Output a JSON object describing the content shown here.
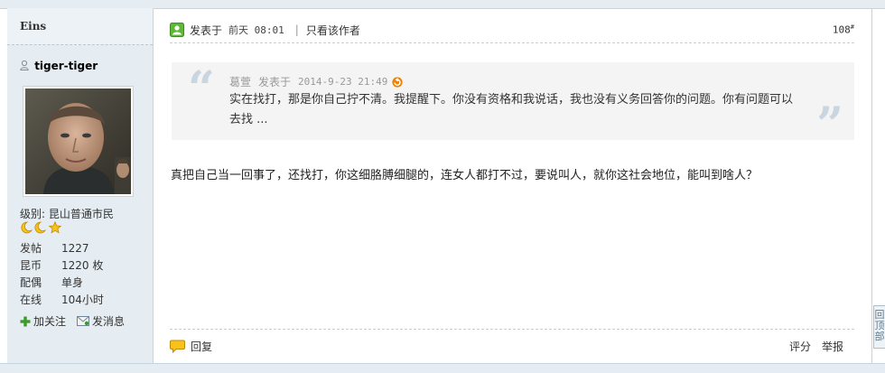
{
  "colors": {
    "sidebar_bg": "#e5edf2",
    "border": "#c2d5e3",
    "quote_bg": "#f4f4f4",
    "accent_orange": "#f08000"
  },
  "author": {
    "name_bar": "Eins",
    "username": "tiger-tiger",
    "level": "级别: 昆山普通市民",
    "stars": [
      "moon-icon",
      "moon-icon",
      "star-icon"
    ],
    "stats": [
      {
        "key": "发帖",
        "value": "1227"
      },
      {
        "key": "昆币",
        "value": "1220 枚"
      },
      {
        "key": "配偶",
        "value": "单身"
      },
      {
        "key": "在线",
        "value": "104小时"
      }
    ],
    "follow_label": "加关注",
    "message_label": "发消息"
  },
  "post": {
    "posted_label": "发表于",
    "posted_time": "前天 08:01",
    "only_author": "只看该作者",
    "floor": "108",
    "floor_sup": "#",
    "quote": {
      "author": "葛萱",
      "posted_label": "发表于",
      "time": "2014-9-23 21:49",
      "text": "实在找打，那是你自己拧不清。我提醒下。你没有资格和我说话，我也没有义务回答你的问题。你有问题可以去找 ..."
    },
    "message": "真把自己当一回事了，还找打，你这细胳膊细腿的，连女人都打不过，要说叫人，就你这社会地位，能叫到啥人？",
    "reply_label": "回复",
    "rate_label": "评分",
    "report_label": "举报"
  },
  "back_to_top": "回顶部"
}
